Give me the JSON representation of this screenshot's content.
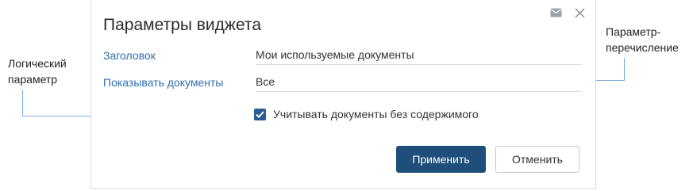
{
  "dialog": {
    "title": "Параметры виджета",
    "fields": [
      {
        "label": "Заголовок",
        "value": "Мои используемые документы"
      },
      {
        "label": "Показывать документы",
        "value": "Все"
      }
    ],
    "checkbox": {
      "label": "Учитывать документы без содержимого",
      "checked": true
    },
    "buttons": {
      "apply": "Применить",
      "cancel": "Отменить"
    },
    "icons": [
      "mail-icon",
      "close-icon"
    ]
  },
  "annotations": {
    "left_line1": "Логический",
    "left_line2": "параметр",
    "right_line1": "Параметр-",
    "right_line2": "перечисление"
  },
  "colors": {
    "accent": "#1f4e7a",
    "label_blue": "#2f6fad",
    "callout_line": "#7aaedc"
  }
}
